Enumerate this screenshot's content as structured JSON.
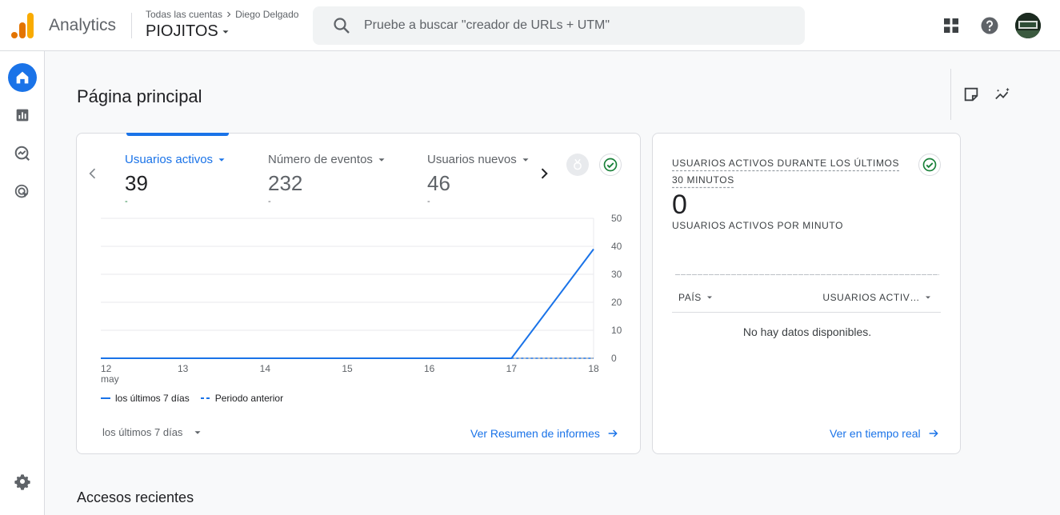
{
  "header": {
    "app_title": "Analytics",
    "breadcrumb": {
      "root": "Todas las cuentas",
      "account": "Diego Delgado"
    },
    "property": "PIOJITOS",
    "search_placeholder": "Pruebe a buscar \"creador de URLs + UTM\""
  },
  "page": {
    "title": "Página principal",
    "recent_title": "Accesos recientes"
  },
  "metrics": [
    {
      "label": "Usuarios activos",
      "value": "39",
      "change": "-"
    },
    {
      "label": "Número de eventos",
      "value": "232",
      "change": "-"
    },
    {
      "label": "Usuarios nuevos",
      "value": "46",
      "change": "-"
    }
  ],
  "chart_data": {
    "type": "line",
    "x": [
      "12",
      "13",
      "14",
      "15",
      "16",
      "17",
      "18"
    ],
    "x_sublabel": "may",
    "y_ticks": [
      "0",
      "10",
      "20",
      "30",
      "40",
      "50"
    ],
    "ylim": [
      0,
      50
    ],
    "series": [
      {
        "name": "los últimos 7 días",
        "values": [
          0,
          0,
          0,
          0,
          0,
          0,
          39
        ],
        "style": "solid"
      },
      {
        "name": "Periodo anterior",
        "values": [
          null,
          null,
          null,
          null,
          null,
          0,
          0
        ],
        "style": "dashed"
      }
    ],
    "grid": true,
    "color": "#1a73e8"
  },
  "overview": {
    "period_label": "los últimos 7 días",
    "report_link": "Ver Resumen de informes"
  },
  "realtime": {
    "title": "USUARIOS ACTIVOS DURANTE LOS ÚLTIMOS 30 MINUTOS",
    "value": "0",
    "subtitle": "USUARIOS ACTIVOS POR MINUTO",
    "col_country": "PAÍS",
    "col_users": "USUARIOS ACTIV…",
    "empty_text": "No hay datos disponibles.",
    "link": "Ver en tiempo real"
  },
  "colors": {
    "accent": "#1a73e8",
    "success": "#188038",
    "logo_orange": "#f9ab00",
    "logo_dark": "#e37400"
  }
}
